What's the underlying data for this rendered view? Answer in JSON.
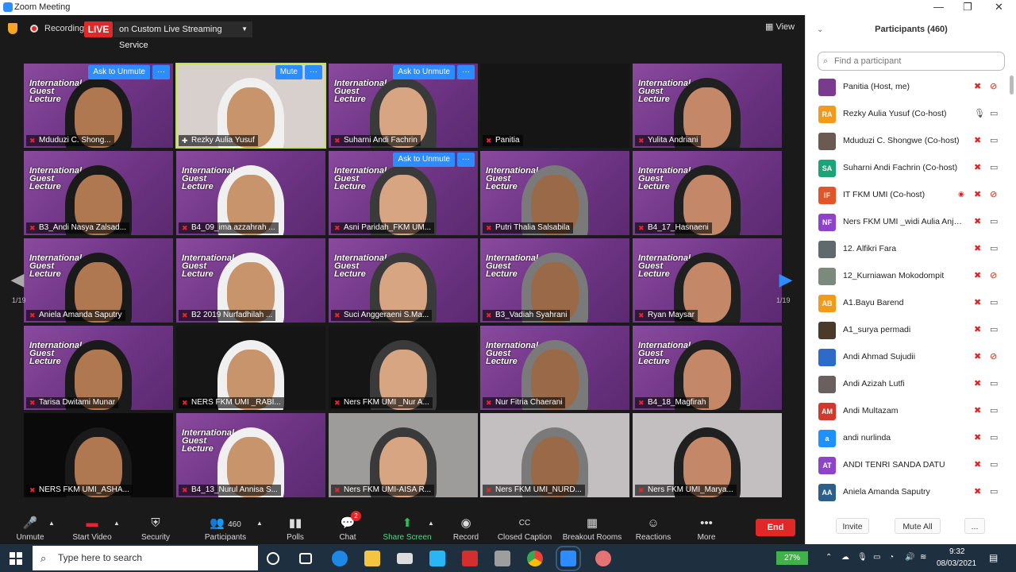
{
  "window": {
    "title": "Zoom Meeting",
    "min": "—",
    "restore": "❐",
    "close": "✕"
  },
  "topbar": {
    "recording_label": "Recording",
    "live_badge": "LIVE",
    "live_service": "on Custom Live Streaming Service",
    "view_label": "View"
  },
  "slide": {
    "line1": "International",
    "line2": "Guest",
    "line3": "Lecture"
  },
  "hover": {
    "ask_unmute": "Ask to Unmute",
    "mute": "Mute",
    "more": "···"
  },
  "tiles": [
    {
      "name": "Mduduzi C. Shong...",
      "bg": "slide",
      "muted": true
    },
    {
      "name": "Rezky Aulia Yusuf",
      "bg": "cam",
      "muted": false
    },
    {
      "name": "Suharni Andi Fachrin",
      "bg": "slide",
      "muted": true
    },
    {
      "name": "Panitia",
      "bg": "dark",
      "muted": true
    },
    {
      "name": "Yulita Andriani",
      "bg": "slide",
      "muted": true
    },
    {
      "name": "B3_Andi Nasya Zalsad...",
      "bg": "slide",
      "muted": true
    },
    {
      "name": "B4_09_ima azzahrah ...",
      "bg": "slide",
      "muted": true
    },
    {
      "name": "Asni Paridah_FKM UM...",
      "bg": "slide",
      "muted": true
    },
    {
      "name": "Putri Thalia Salsabila",
      "bg": "slide",
      "muted": true
    },
    {
      "name": "B4_17_Hasnaeni",
      "bg": "slide",
      "muted": true
    },
    {
      "name": "Aniela Amanda Saputry",
      "bg": "slide",
      "muted": true
    },
    {
      "name": "B2 2019 Nurfadhilah ...",
      "bg": "slide",
      "muted": true
    },
    {
      "name": "Suci Anggeraeni S.Ma...",
      "bg": "slide",
      "muted": true
    },
    {
      "name": "B3_Vadiah Syahrani",
      "bg": "slide",
      "muted": true
    },
    {
      "name": "Ryan Maysar",
      "bg": "slide",
      "muted": true
    },
    {
      "name": "Tarisa Dwitami Munar",
      "bg": "slide",
      "muted": true
    },
    {
      "name": "NERS FKM UMI _RABI...",
      "bg": "dark",
      "muted": true
    },
    {
      "name": "Ners FKM UMI _Nur A...",
      "bg": "dark",
      "muted": true
    },
    {
      "name": "Nur Fitria Chaerani",
      "bg": "slide",
      "muted": true
    },
    {
      "name": "B4_18_Magfirah",
      "bg": "slide",
      "muted": true
    },
    {
      "name": "NERS FKM UMI_ASHA...",
      "bg": "black",
      "muted": true
    },
    {
      "name": "B4_13_Nurul Annisa S...",
      "bg": "slide",
      "muted": true
    },
    {
      "name": "Ners FKM UMI-AISA R...",
      "bg": "grey",
      "muted": true
    },
    {
      "name": "Ners FKM UMI_NURD...",
      "bg": "photo",
      "muted": true
    },
    {
      "name": "Ners FKM UMI_Marya...",
      "bg": "photo",
      "muted": true
    }
  ],
  "pager": {
    "left": "1/19",
    "right": "1/19"
  },
  "bottombar": {
    "unmute": "Unmute",
    "start_video": "Start Video",
    "security": "Security",
    "participants_count": "460",
    "participants": "Participants",
    "polls": "Polls",
    "chat": "Chat",
    "chat_badge": "2",
    "share_screen": "Share Screen",
    "record": "Record",
    "closed_caption": "Closed Caption",
    "closed_caption_icon": "CC",
    "breakout_rooms": "Breakout Rooms",
    "reactions": "Reactions",
    "more": "More",
    "end": "End"
  },
  "panel": {
    "title": "Participants (460)",
    "search_placeholder": "Find a participant",
    "participants": [
      {
        "name": "Panitia (Host, me)",
        "initials": "",
        "color": "#7a3b8e",
        "video_off": true
      },
      {
        "name": "Rezky Aulia Yusuf (Co-host)",
        "initials": "RA",
        "color": "#f29a1b",
        "video_off": false,
        "mic_on": true
      },
      {
        "name": "Mduduzi C. Shongwe (Co-host)",
        "initials": "",
        "color": "#6a5a52",
        "video_off": false
      },
      {
        "name": "Suharni Andi Fachrin (Co-host)",
        "initials": "SA",
        "color": "#1ba37a",
        "video_off": false
      },
      {
        "name": "IT FKM UMI (Co-host)",
        "initials": "IF",
        "color": "#e0562a",
        "video_off": true,
        "recording": true
      },
      {
        "name": "Ners FKM UMI _widi Aulia Anjasa...",
        "initials": "NF",
        "color": "#8e44c8",
        "video_off": false
      },
      {
        "name": "12. Alfikri Fara",
        "initials": "",
        "color": "#5f6a6e",
        "video_off": false
      },
      {
        "name": "12_Kurniawan Mokodompit",
        "initials": "",
        "color": "#7b8a7c",
        "video_off": true
      },
      {
        "name": "A1.Bayu Barend",
        "initials": "AB",
        "color": "#f29a1b",
        "video_off": false
      },
      {
        "name": "A1_surya permadi",
        "initials": "",
        "color": "#4a3a2a",
        "video_off": false
      },
      {
        "name": "Andi Ahmad Sujudii",
        "initials": "",
        "color": "#2d6bc9",
        "video_off": true
      },
      {
        "name": "Andi Azizah Lutfi",
        "initials": "",
        "color": "#6a6060",
        "video_off": false
      },
      {
        "name": "Andi Multazam",
        "initials": "AM",
        "color": "#d0392b",
        "video_off": false
      },
      {
        "name": "andi nurlinda",
        "initials": "a",
        "color": "#1e90ff",
        "video_off": false
      },
      {
        "name": "ANDI TENRI SANDA DATU",
        "initials": "AT",
        "color": "#8e44c8",
        "video_off": false
      },
      {
        "name": "Aniela Amanda Saputry",
        "initials": "AA",
        "color": "#2c5f8a",
        "video_off": false
      }
    ],
    "invite": "Invite",
    "mute_all": "Mute All",
    "more": "..."
  },
  "taskbar": {
    "search_placeholder": "Type here to search",
    "battery": "27%",
    "time": "9:32",
    "date": "08/03/2021"
  }
}
